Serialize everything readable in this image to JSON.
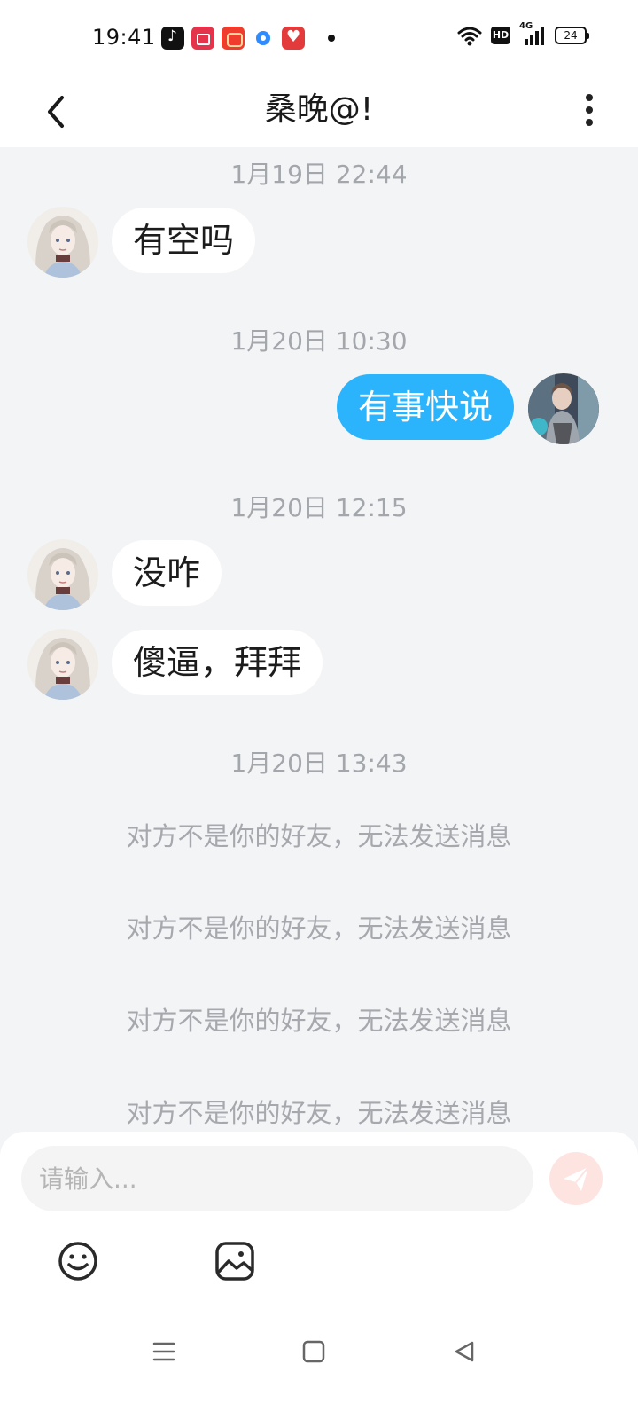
{
  "status_bar": {
    "time": "19:41",
    "app_icons": [
      "tiktok-icon",
      "video-icon",
      "shop-icon",
      "browser-icon",
      "heart-app-icon"
    ],
    "hd_label": "HD",
    "network_label": "4G",
    "battery_level": "24"
  },
  "header": {
    "title": "桑晚@!",
    "back_icon": "chevron-left-icon",
    "more_icon": "vertical-ellipsis-icon"
  },
  "messages": {
    "ts1": "1月19日 22:44",
    "msg1": "有空吗",
    "ts2": "1月20日 10:30",
    "msg2": "有事快说",
    "ts3": "1月20日 12:15",
    "msg3": "没咋",
    "msg4": "傻逼，拜拜",
    "ts4": "1月20日 13:43",
    "notices": [
      "对方不是你的好友，无法发送消息",
      "对方不是你的好友，无法发送消息",
      "对方不是你的好友，无法发送消息",
      "对方不是你的好友，无法发送消息"
    ]
  },
  "composer": {
    "placeholder": "请输入...",
    "send_icon": "paper-plane-icon",
    "emoji_icon": "smiley-icon",
    "image_icon": "image-icon"
  },
  "colors": {
    "outgoing_bubble": "#2bb4fb",
    "incoming_bubble": "#ffffff",
    "background": "#f3f4f6",
    "timestamp_text": "#a3a6ab",
    "send_button": "#fde4e1"
  }
}
